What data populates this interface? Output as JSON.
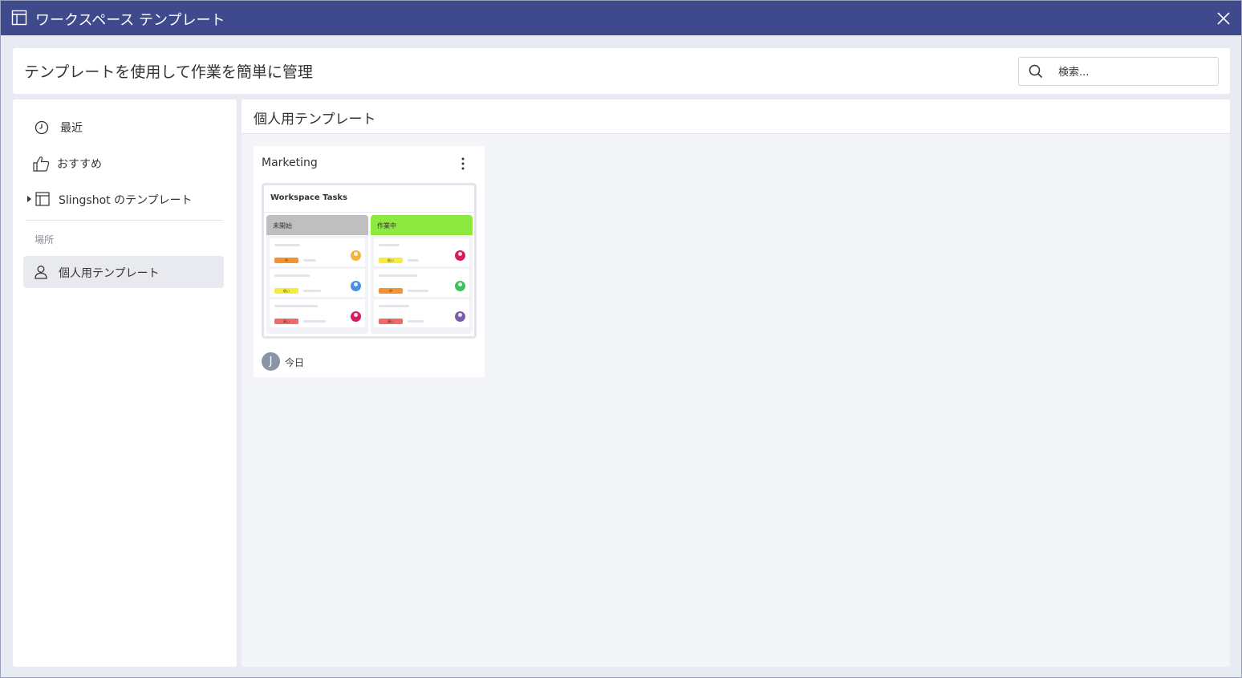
{
  "window": {
    "title": "ワークスペース テンプレート"
  },
  "header": {
    "subtitle": "テンプレートを使用して作業を簡単に管理",
    "search": {
      "placeholder": "検索..."
    }
  },
  "sidebar": {
    "items": [
      {
        "label": "最近",
        "icon": "clock-icon"
      },
      {
        "label": "おすすめ",
        "icon": "thumbs-up-icon"
      },
      {
        "label": "Slingshot のテンプレート",
        "icon": "template-icon"
      }
    ],
    "section_label": "場所",
    "places": [
      {
        "label": "個人用テンプレート",
        "icon": "user-icon",
        "active": true
      }
    ]
  },
  "main": {
    "section_title": "個人用テンプレート",
    "cards": [
      {
        "title": "Marketing",
        "owner_initial": "J",
        "date": "今日",
        "preview": {
          "title": "Workspace Tasks",
          "columns": [
            {
              "name": "未開始",
              "color": "#bfbfbf",
              "items": [
                {
                  "tag": "中",
                  "tag_color": "#f5922f",
                  "avatar_color": "#f2b43c"
                },
                {
                  "tag": "低い",
                  "tag_color": "#f7ec3c",
                  "avatar_color": "#4a90e2"
                },
                {
                  "tag": "高い",
                  "tag_color": "#f06a6a",
                  "avatar_color": "#d81b60"
                }
              ]
            },
            {
              "name": "作業中",
              "color": "#8de840",
              "items": [
                {
                  "tag": "低い",
                  "tag_color": "#f7ec3c",
                  "avatar_color": "#d81b60"
                },
                {
                  "tag": "中",
                  "tag_color": "#f5922f",
                  "avatar_color": "#3fc05a"
                },
                {
                  "tag": "高い",
                  "tag_color": "#f06a6a",
                  "avatar_color": "#7b5ea7"
                }
              ]
            }
          ]
        }
      }
    ]
  }
}
